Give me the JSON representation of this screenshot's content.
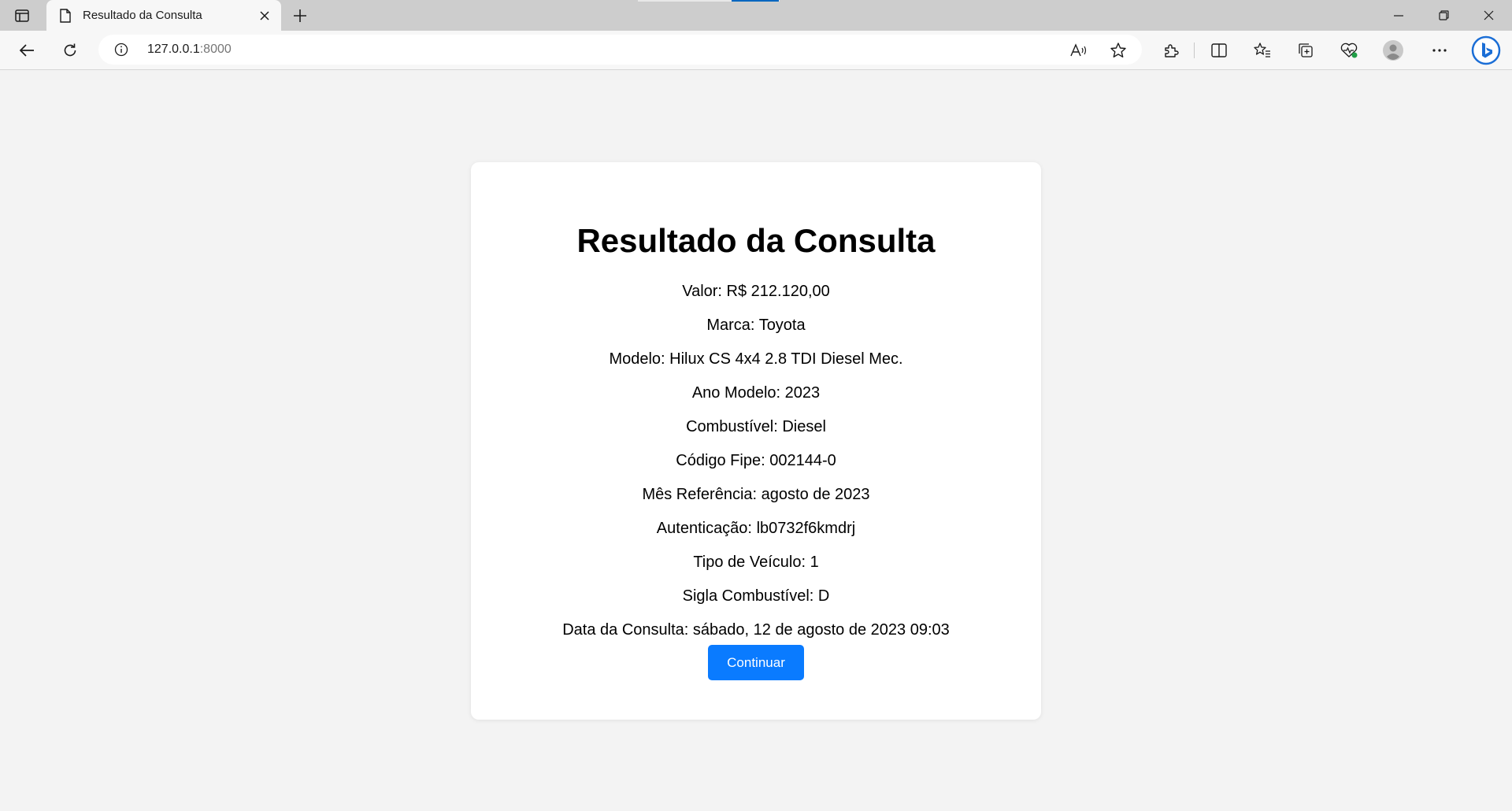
{
  "browser": {
    "tab_title": "Resultado da Consulta",
    "url_host": "127.0.0.1",
    "url_port": ":8000",
    "accent_color": "#0067c0"
  },
  "page": {
    "title": "Resultado da Consulta",
    "fields": [
      {
        "label": "Valor:",
        "value": "R$ 212.120,00"
      },
      {
        "label": "Marca:",
        "value": "Toyota"
      },
      {
        "label": "Modelo:",
        "value": "Hilux CS 4x4 2.8 TDI Diesel Mec."
      },
      {
        "label": "Ano Modelo:",
        "value": "2023"
      },
      {
        "label": "Combustível:",
        "value": "Diesel"
      },
      {
        "label": "Código Fipe:",
        "value": "002144-0"
      },
      {
        "label": "Mês Referência:",
        "value": "agosto de 2023"
      },
      {
        "label": "Autenticação:",
        "value": "lb0732f6kmdrj"
      },
      {
        "label": "Tipo de Veículo:",
        "value": "1"
      },
      {
        "label": "Sigla Combustível:",
        "value": "D"
      },
      {
        "label": "Data da Consulta:",
        "value": "sábado, 12 de agosto de 2023 09:03"
      }
    ],
    "continue_label": "Continuar",
    "button_color": "#0a7bff"
  }
}
